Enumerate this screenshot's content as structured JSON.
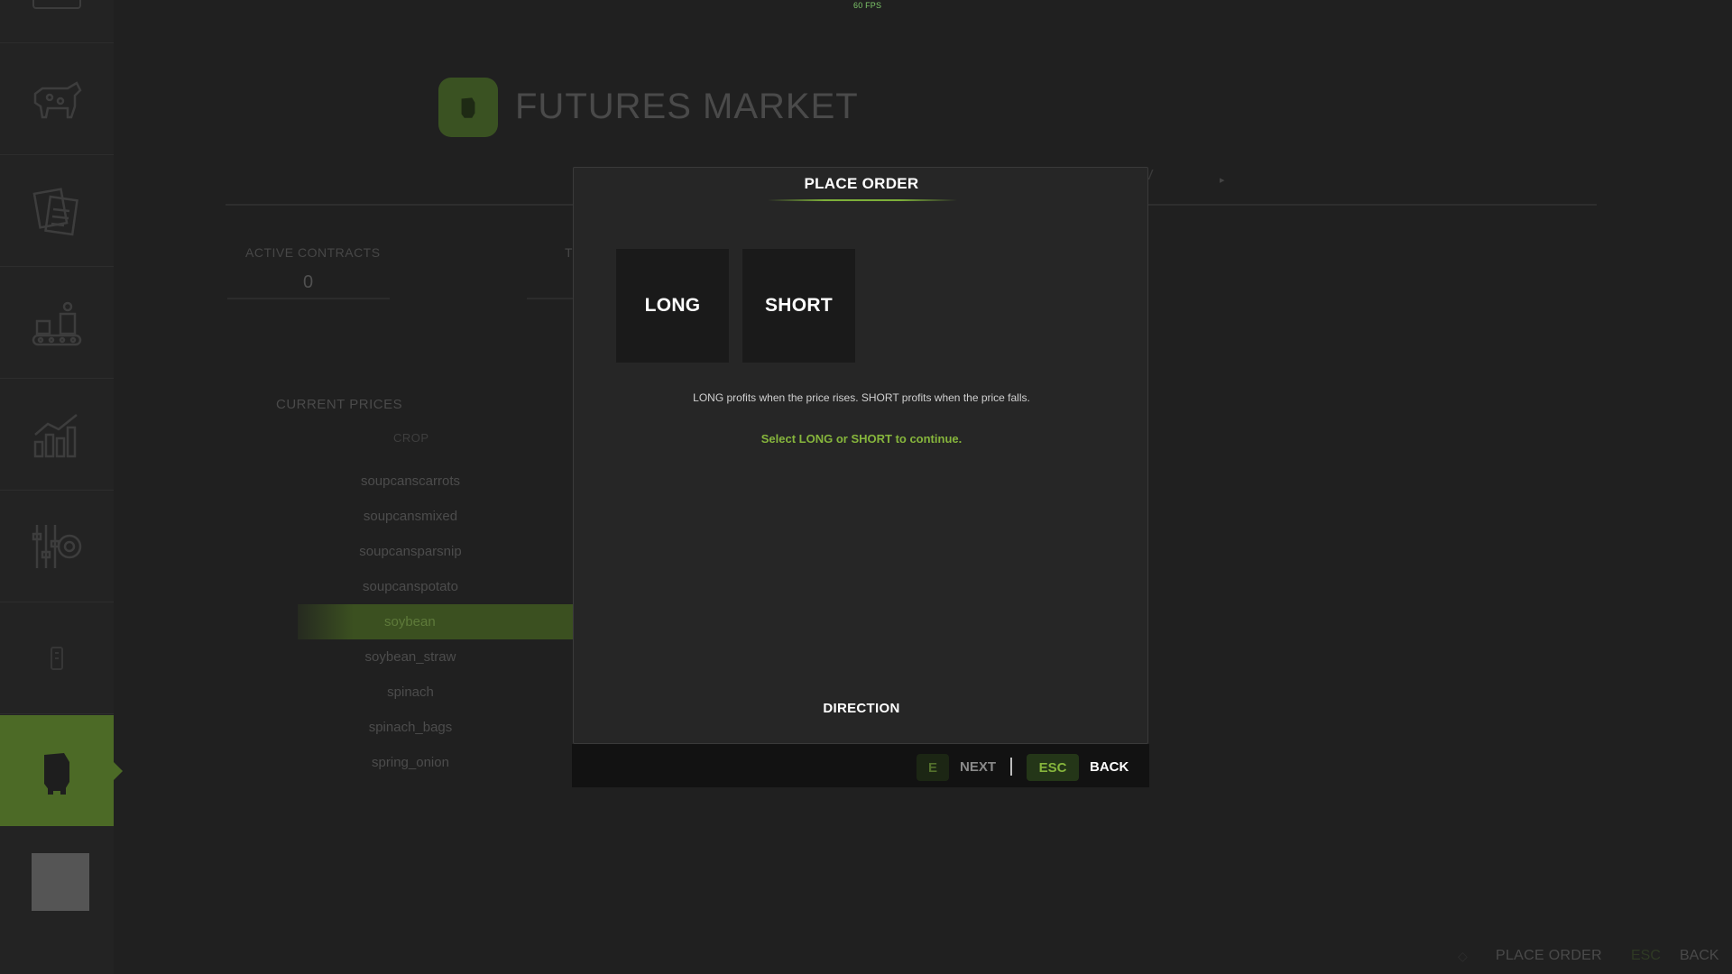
{
  "fps": "60 FPS",
  "header": {
    "title": "FUTURES MARKET",
    "tab_hint": "V",
    "tab_arrow": "▸"
  },
  "sidebar": {
    "items": [
      {
        "icon": "cow-icon"
      },
      {
        "icon": "contracts-icon"
      },
      {
        "icon": "production-icon"
      },
      {
        "icon": "statistics-icon"
      },
      {
        "icon": "settings-icon"
      },
      {
        "icon": "help-icon"
      },
      {
        "icon": "futures-icon",
        "active": true
      }
    ]
  },
  "stats": {
    "active_contracts_label": "ACTIVE CONTRACTS",
    "active_contracts_value": "0",
    "second_label": "T"
  },
  "prices": {
    "label": "CURRENT PRICES",
    "column": "CROP",
    "crops": [
      "soupcanscarrots",
      "soupcansmixed",
      "soupcansparsnip",
      "soupcanspotato",
      "soybean",
      "soybean_straw",
      "spinach",
      "spinach_bags",
      "spring_onion"
    ],
    "selected_index": 4
  },
  "dialog": {
    "title": "PLACE ORDER",
    "long_label": "LONG",
    "short_label": "SHORT",
    "description": "LONG profits when the price rises. SHORT profits when the price falls.",
    "hint": "Select LONG or SHORT to continue.",
    "step": "DIRECTION",
    "footer": {
      "next_key": "E",
      "next_label": "NEXT",
      "back_key": "ESC",
      "back_label": "BACK"
    }
  },
  "bottom_bar": {
    "place_order": "PLACE ORDER",
    "esc": "ESC",
    "back": "BACK"
  },
  "colors": {
    "accent": "#86b53c",
    "active_tab": "#4c6a26",
    "dialog_bg": "#262626"
  }
}
